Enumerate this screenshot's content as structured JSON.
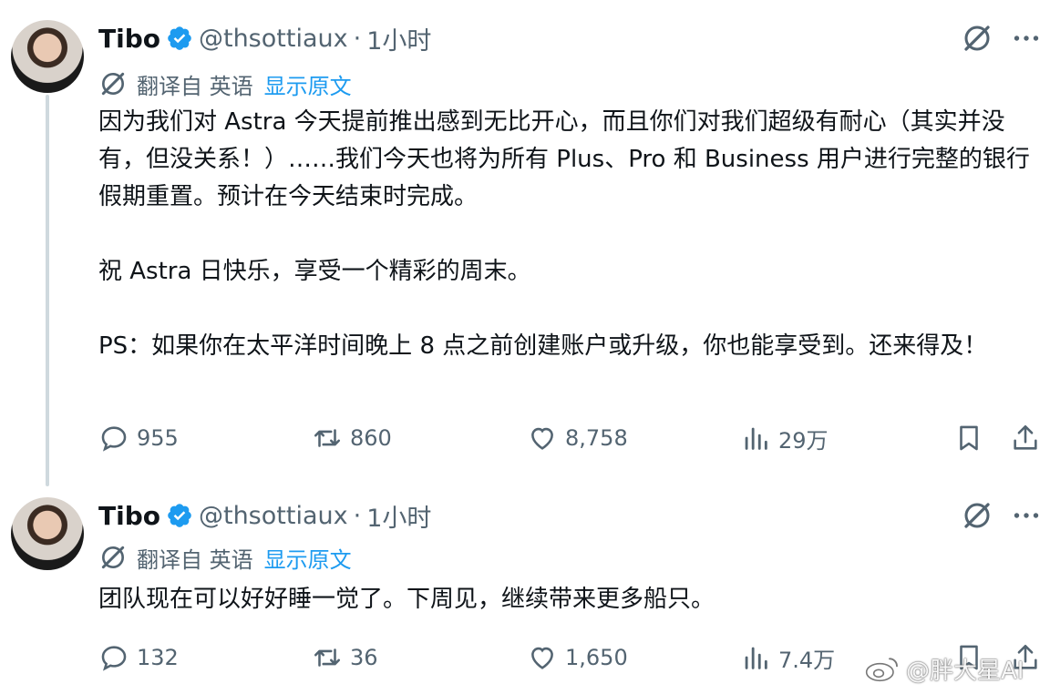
{
  "tweets": [
    {
      "author_name": "Tibo",
      "handle": "@thsottiaux",
      "separator": "·",
      "time": "1小时",
      "translate_label": "翻译自 英语",
      "show_original": "显示原文",
      "paragraphs": [
        "因为我们对 Astra 今天提前推出感到无比开心，而且你们对我们超级有耐心（其实并没有，但没关系！）……我们今天也将为所有 Plus、Pro 和 Business 用户进行完整的银行假期重置。预计在今天结束时完成。",
        "祝 Astra 日快乐，享受一个精彩的周末。",
        "PS：如果你在太平洋时间晚上 8 点之前创建账户或升级，你也能享受到。还来得及！"
      ],
      "replies": "955",
      "reposts": "860",
      "likes": "8,758",
      "views": "29万"
    },
    {
      "author_name": "Tibo",
      "handle": "@thsottiaux",
      "separator": "·",
      "time": "1小时",
      "translate_label": "翻译自 英语",
      "show_original": "显示原文",
      "paragraphs": [
        "团队现在可以好好睡一觉了。下周见，继续带来更多船只。"
      ],
      "replies": "132",
      "reposts": "36",
      "likes": "1,650",
      "views": "7.4万"
    }
  ],
  "watermark": "@胖大星AI",
  "colors": {
    "accent": "#1d9bf0",
    "secondary_text": "#536471",
    "primary_text": "#0f1419",
    "thread_line": "#cfd9de"
  },
  "icons": [
    "verified-badge-icon",
    "grok-icon",
    "more-icon",
    "translate-icon",
    "reply-icon",
    "repost-icon",
    "like-icon",
    "views-icon",
    "bookmark-icon",
    "share-icon",
    "weibo-icon"
  ]
}
